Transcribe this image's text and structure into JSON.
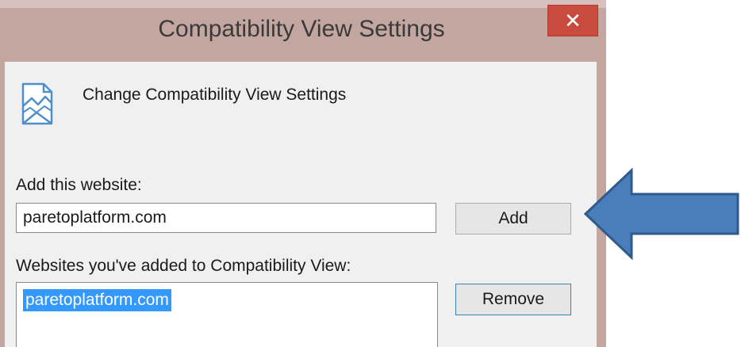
{
  "window": {
    "title": "Compatibility View Settings",
    "close_glyph": "✕"
  },
  "dialog": {
    "heading": "Change Compatibility View Settings",
    "heading_icon": "compatibility-view-icon",
    "add_label": "Add this website:",
    "add_input_value": "paretoplatform.com",
    "add_button": "Add",
    "list_label": "Websites you've added to Compatibility View:",
    "list_items": [
      "paretoplatform.com"
    ],
    "remove_button": "Remove"
  },
  "annotation": {
    "arrow_icon": "left-arrow-icon",
    "arrow_color": "#4a7ebb",
    "arrow_outline": "#2e5a8c"
  },
  "colors": {
    "titlebar": "#c4a6a1",
    "close_button": "#c94a3e",
    "selection": "#3399ff",
    "dialog_bg": "#f0f0f0"
  }
}
